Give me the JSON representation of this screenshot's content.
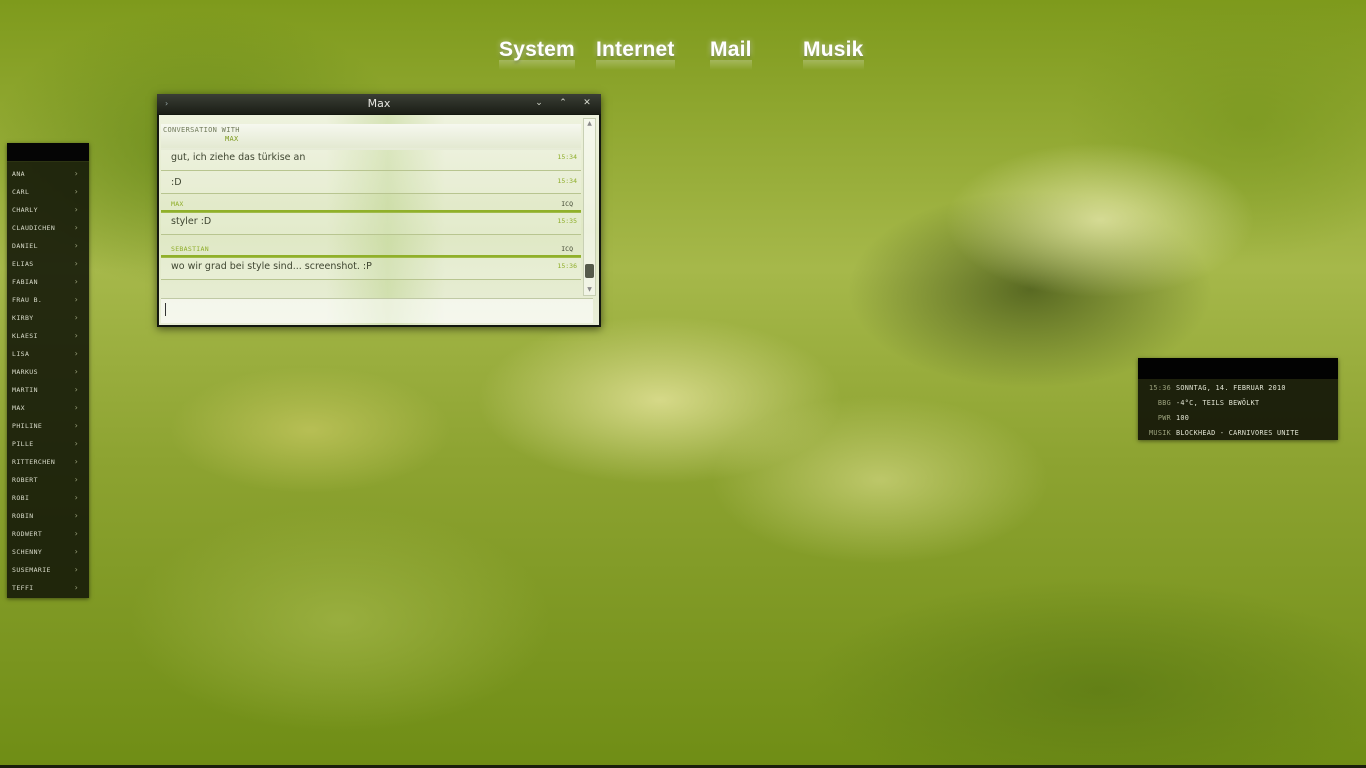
{
  "top_menu": {
    "items": [
      "System",
      "Internet",
      "Mail",
      "Musik"
    ]
  },
  "contacts": {
    "items": [
      "ANA",
      "CARL",
      "CHARLY",
      "CLAUDICHEN",
      "DANIEL",
      "ELIAS",
      "FABIAN",
      "FRAU B.",
      "KIRBY",
      "KLAESI",
      "LISA",
      "MARKUS",
      "MARTIN",
      "MAX",
      "PHILINE",
      "PILLE",
      "RITTERCHEN",
      "ROBERT",
      "ROBI",
      "ROBIN",
      "RODWERT",
      "SCHENNY",
      "SUSEMARIE",
      "TEFFI"
    ],
    "chevron": "›"
  },
  "chat": {
    "title": "Max",
    "menu_glyph": "›",
    "controls": {
      "minimize": "⌄",
      "maximize": "⌃",
      "close": "✕"
    },
    "conversation_label": "CONVERSATION WITH",
    "conversation_partner": "MAX",
    "messages": [
      {
        "text": "gut, ich ziehe das türkise an",
        "time": "15:34"
      },
      {
        "text": ":D",
        "time": "15:34"
      },
      {
        "sender": "MAX",
        "protocol": "ICQ"
      },
      {
        "text": "styler :D",
        "time": "15:35"
      },
      {
        "sender": "SEBASTIAN",
        "protocol": "ICQ"
      },
      {
        "text": "wo wir grad bei style sind... screenshot. :P",
        "time": "15:36"
      }
    ],
    "input_value": ""
  },
  "info_panel": {
    "rows": [
      {
        "key": "15:36",
        "value": "SONNTAG, 14. FEBRUAR 2010"
      },
      {
        "key": "BBG",
        "value": "-4°C, TEILS BEWÖLKT"
      },
      {
        "key": "PWR",
        "value": "100"
      },
      {
        "key": "MUSIK",
        "value": "BLOCKHEAD - CARNIVORES UNITE"
      }
    ]
  },
  "colors": {
    "accent": "#90b02a",
    "panel_bg": "#12160a",
    "text_light": "#e0e3d2"
  }
}
